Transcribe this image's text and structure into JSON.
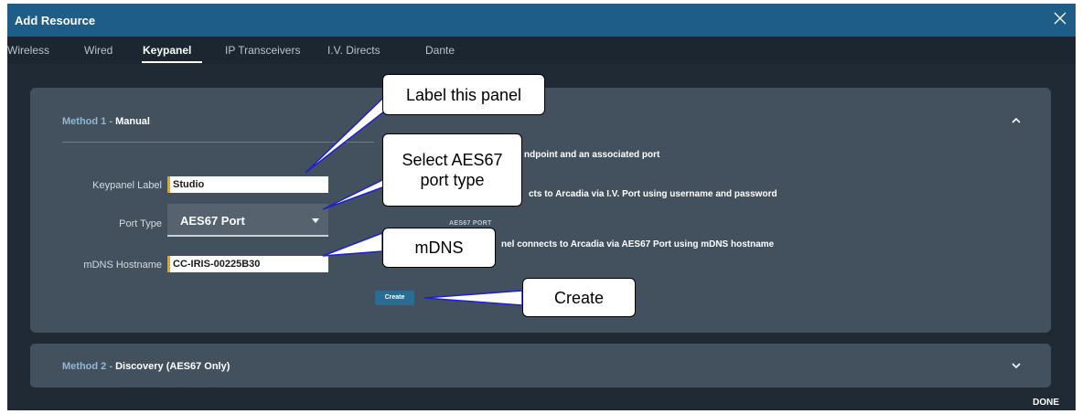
{
  "dialog": {
    "title": "Add Resource",
    "close_icon": "close-icon",
    "done_label": "DONE"
  },
  "tabs": [
    {
      "label": "Wireless",
      "active": false
    },
    {
      "label": "Wired",
      "active": false
    },
    {
      "label": "Keypanel",
      "active": true
    },
    {
      "label": "IP Transceivers",
      "active": false
    },
    {
      "label": "I.V. Directs",
      "active": false
    },
    {
      "label": "Dante",
      "active": false
    }
  ],
  "method1": {
    "prefix": "Method 1 -",
    "name": "Manual",
    "expanded": true,
    "chevron_icon": "chevron-up-icon",
    "keypanel_label": {
      "label": "Keypanel Label",
      "value": "Studio"
    },
    "port_type": {
      "label": "Port Type",
      "value": "AES67 Port"
    },
    "mdns_hostname": {
      "label": "mDNS Hostname",
      "value": "CC-IRIS-00225B30"
    },
    "desc1": "ndpoint and an associated port",
    "desc2": "cts to Arcadia via I.V. Port using username and password",
    "section_tag": "AES67 PORT",
    "desc3": "nel connects to Arcadia via AES67 Port using mDNS hostname",
    "create_label": "Create"
  },
  "method2": {
    "prefix": "Method 2 -",
    "name": "Discovery (AES67 Only)",
    "expanded": false,
    "chevron_icon": "chevron-down-icon"
  },
  "callouts": {
    "label_panel": "Label this panel",
    "select_port_line1": "Select AES67",
    "select_port_line2": "port type",
    "mdns": "mDNS",
    "create": "Create"
  },
  "colors": {
    "title_bar": "#1f5d89",
    "dialog_bg": "#1f2a35",
    "panel_bg": "#43515f",
    "input_accent": "#f0a500",
    "button": "#2a6c93",
    "callout_line": "#1f1fd0"
  }
}
